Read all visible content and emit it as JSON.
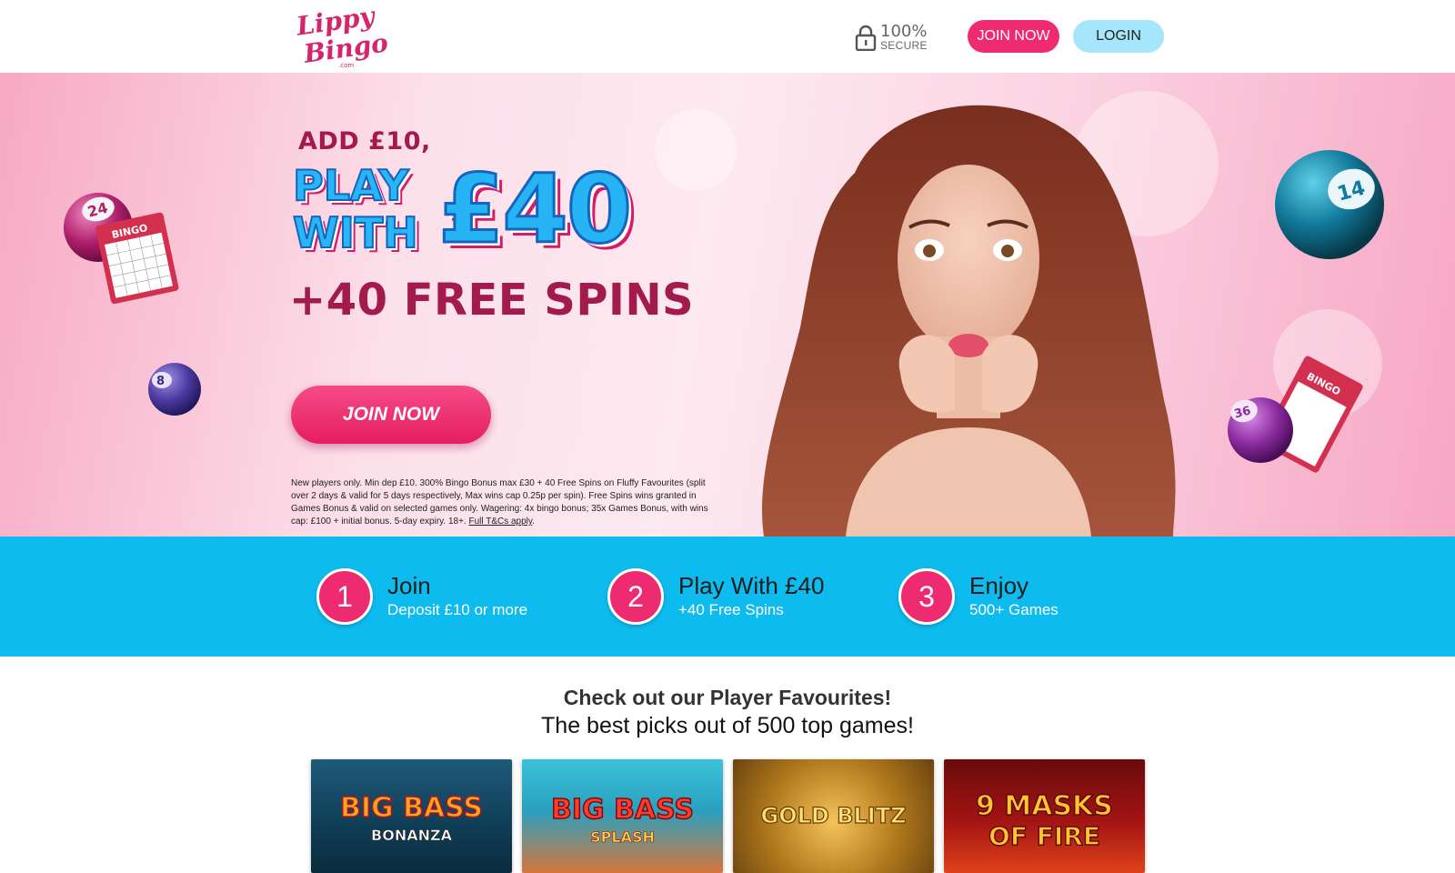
{
  "brand": {
    "logo_line1": "Lippy",
    "logo_line2": "Bingo",
    "logo_suffix": ".com",
    "pink": "#e8236f",
    "blue": "#0ebbef"
  },
  "header": {
    "secure_percent": "100%",
    "secure_label": "SECURE",
    "join_label": "JOIN NOW",
    "login_label": "LOGIN"
  },
  "hero": {
    "line1": "ADD £10,",
    "line2a": "PLAY",
    "line2b": "WITH",
    "amount": "£40",
    "line3": "+40 FREE SPINS",
    "cta_label": "JOIN NOW",
    "terms_text": "New players only. Min dep £10. 300% Bingo Bonus max £30 + 40 Free Spins on Fluffy Favourites (split over 2 days & valid for 5 days respectively, Max wins cap 0.25p per spin). Free Spins wins granted in Games Bonus & valid on selected games only. Wagering: 4x bingo bonus; 35x Games Bonus, with wins cap: £100 + initial bonus. 5-day expiry. 18+.",
    "terms_link": "Full T&Cs apply",
    "terms_end": ".",
    "ball_numbers": [
      "24",
      "8",
      "14",
      "36"
    ],
    "card_label": "BINGO"
  },
  "steps": [
    {
      "num": "1",
      "title": "Join",
      "sub": "Deposit £10 or more"
    },
    {
      "num": "2",
      "title": "Play With £40",
      "sub": "+40 Free Spins"
    },
    {
      "num": "3",
      "title": "Enjoy",
      "sub": "500+ Games"
    }
  ],
  "favourites": {
    "title": "Check out our Player Favourites!",
    "subtitle": "The best picks out of 500 top games!",
    "games": [
      {
        "line1": "BIG BASS",
        "line2": "BONANZA"
      },
      {
        "line1": "BIG BASS",
        "line2": "SPLASH"
      },
      {
        "line1": "GOLD BLITZ",
        "line2": ""
      },
      {
        "line1": "9 MASKS",
        "line2": "OF FIRE"
      }
    ]
  }
}
